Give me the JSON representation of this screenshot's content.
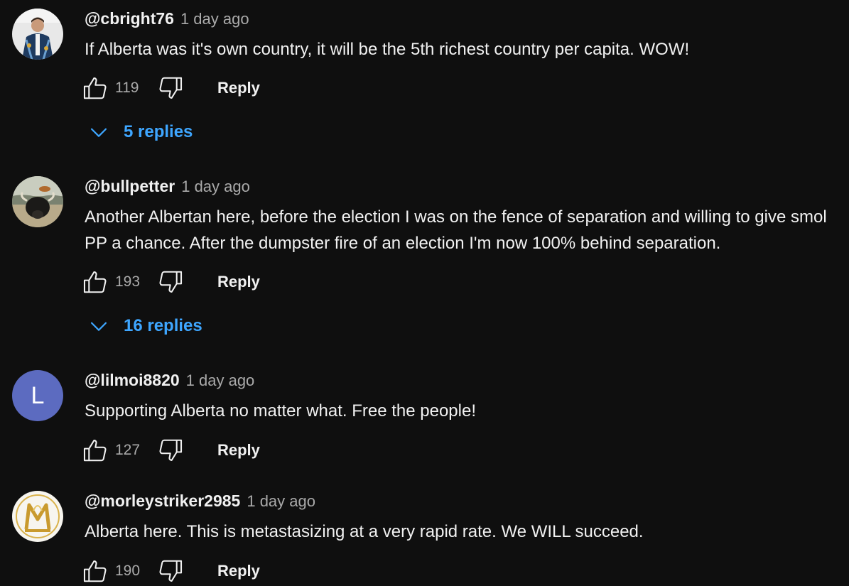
{
  "comments": [
    {
      "author": "@cbright76",
      "time": "1 day ago",
      "text": "If Alberta was it's own country, it will be the 5th richest country per capita. WOW!",
      "likes": "119",
      "reply_label": "Reply",
      "replies": "5 replies",
      "avatar": "photo-avatar-person"
    },
    {
      "author": "@bullpetter",
      "time": "1 day ago",
      "text": "Another Albertan here, before the election I was on the fence of separation and willing to give smol PP a chance. After the dumpster fire of an election I'm now 100% behind separation.",
      "likes": "193",
      "reply_label": "Reply",
      "replies": "16 replies",
      "avatar": "photo-avatar-yak"
    },
    {
      "author": "@lilmoi8820",
      "time": "1 day ago",
      "text": "Supporting Alberta no matter what. Free the people!",
      "likes": "127",
      "reply_label": "Reply",
      "avatar_letter": "L",
      "avatar_color": "#5c6bc0"
    },
    {
      "author": "@morleystriker2985",
      "time": "1 day ago",
      "text": "Alberta here. This is metastasizing at a very rapid rate. We WILL succeed.",
      "likes": "190",
      "reply_label": "Reply",
      "avatar": "photo-avatar-gold-monogram",
      "avatar_letter": "M"
    }
  ],
  "colors": {
    "background": "#0f0f0f",
    "text_primary": "#f1f1f1",
    "text_secondary": "#aaaaaa",
    "link_blue": "#3ea6ff"
  },
  "icons": {
    "like": "thumbs-up-icon",
    "dislike": "thumbs-down-icon",
    "expand": "chevron-down-icon"
  }
}
